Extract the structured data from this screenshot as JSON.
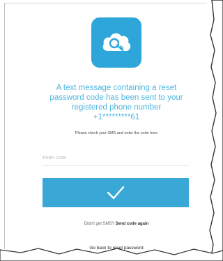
{
  "colors": {
    "accent": "#2ea6d9",
    "button": "#3aa8d6",
    "headline": "#4fb6e0"
  },
  "logo": {
    "icon": "cloud-key-icon"
  },
  "message": {
    "headline_line1": "A text message containing a reset",
    "headline_line2": "password code has been sent to your",
    "headline_line3": "registered phone number",
    "headline_line4": "+1*********61",
    "instruction": "Please check your SMS and enter the code here"
  },
  "form": {
    "code_placeholder": "Enter code",
    "submit_icon": "checkmark-icon"
  },
  "links": {
    "resend_prompt": "Didn't get SMS?",
    "resend_label": "Send code again",
    "back_label": "Go back to reset password"
  }
}
